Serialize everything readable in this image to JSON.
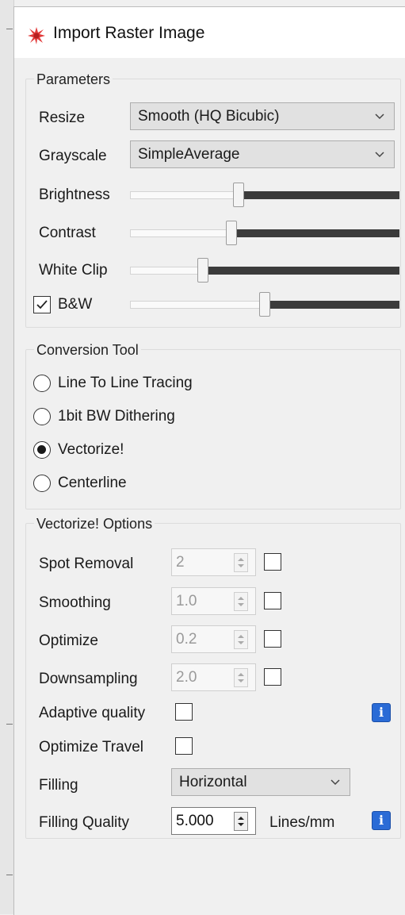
{
  "window": {
    "title": "Import Raster Image",
    "icon": "laser-burst-icon"
  },
  "parameters": {
    "legend": "Parameters",
    "resize": {
      "label": "Resize",
      "value": "Smooth (HQ Bicubic)"
    },
    "grayscale": {
      "label": "Grayscale",
      "value": "SimpleAverage"
    },
    "brightness": {
      "label": "Brightness",
      "level": 0.4
    },
    "contrast": {
      "label": "Contrast",
      "level": 0.37
    },
    "white_clip": {
      "label": "White Clip",
      "level": 0.26
    },
    "bw": {
      "label": "B&W",
      "checked": true,
      "level": 0.5
    }
  },
  "conversion": {
    "legend": "Conversion Tool",
    "options": [
      {
        "label": "Line To Line Tracing",
        "selected": false
      },
      {
        "label": "1bit BW Dithering",
        "selected": false
      },
      {
        "label": "Vectorize!",
        "selected": true
      },
      {
        "label": "Centerline",
        "selected": false
      }
    ]
  },
  "vectorize": {
    "legend": "Vectorize! Options",
    "spot_removal": {
      "label": "Spot Removal",
      "value": "2",
      "checked": false
    },
    "smoothing": {
      "label": "Smoothing",
      "value": "1.0",
      "checked": false
    },
    "optimize": {
      "label": "Optimize",
      "value": "0.2",
      "checked": false
    },
    "downsampling": {
      "label": "Downsampling",
      "value": "2.0",
      "checked": false
    },
    "adaptive_quality": {
      "label": "Adaptive quality",
      "checked": false
    },
    "optimize_travel": {
      "label": "Optimize Travel",
      "checked": false
    },
    "filling": {
      "label": "Filling",
      "value": "Horizontal"
    },
    "filling_quality": {
      "label": "Filling Quality",
      "value": "5.000",
      "unit": "Lines/mm"
    }
  },
  "colors": {
    "info": "#2a6bd6",
    "laser": "#e23a3a",
    "slider_dark": "#3b3b3b"
  }
}
